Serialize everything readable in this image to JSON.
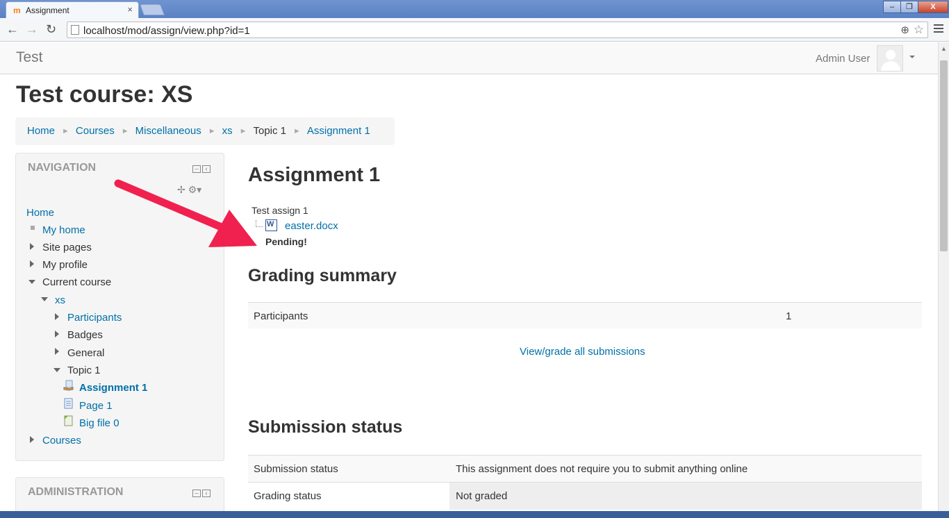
{
  "browser": {
    "tab_title": "Assignment",
    "tab_favicon": "m",
    "tab_close": "×",
    "url": "localhost/mod/assign/view.php?id=1",
    "window_buttons": [
      "‒",
      "❐",
      "X"
    ]
  },
  "site": {
    "brand": "Test",
    "user_name": "Admin User"
  },
  "course_title": "Test course: XS",
  "breadcrumb": {
    "home": "Home",
    "courses": "Courses",
    "misc": "Miscellaneous",
    "xs": "xs",
    "topic": "Topic 1",
    "assignment": "Assignment 1",
    "sep": "►"
  },
  "navigation": {
    "title": "NAVIGATION",
    "home": "Home",
    "my_home": "My home",
    "site_pages": "Site pages",
    "my_profile": "My profile",
    "current_course": "Current course",
    "xs": "xs",
    "participants": "Participants",
    "badges": "Badges",
    "general": "General",
    "topic1": "Topic 1",
    "assignment1": "Assignment 1",
    "page1": "Page 1",
    "bigfile": "Big file 0",
    "courses": "Courses"
  },
  "administration": {
    "title": "ADMINISTRATION"
  },
  "main": {
    "heading": "Assignment 1",
    "intro": "Test assign 1",
    "file": "easter.docx",
    "pending": "Pending!",
    "grading_summary": {
      "heading": "Grading summary",
      "participants_label": "Participants",
      "participants_value": "1",
      "view_all": "View/grade all submissions"
    },
    "submission_status": {
      "heading": "Submission status",
      "rows": [
        {
          "label": "Submission status",
          "value": "This assignment does not require you to submit anything online"
        },
        {
          "label": "Grading status",
          "value": "Not graded"
        }
      ]
    }
  },
  "colors": {
    "link": "#0070a8",
    "arrow": "#f0214f"
  }
}
